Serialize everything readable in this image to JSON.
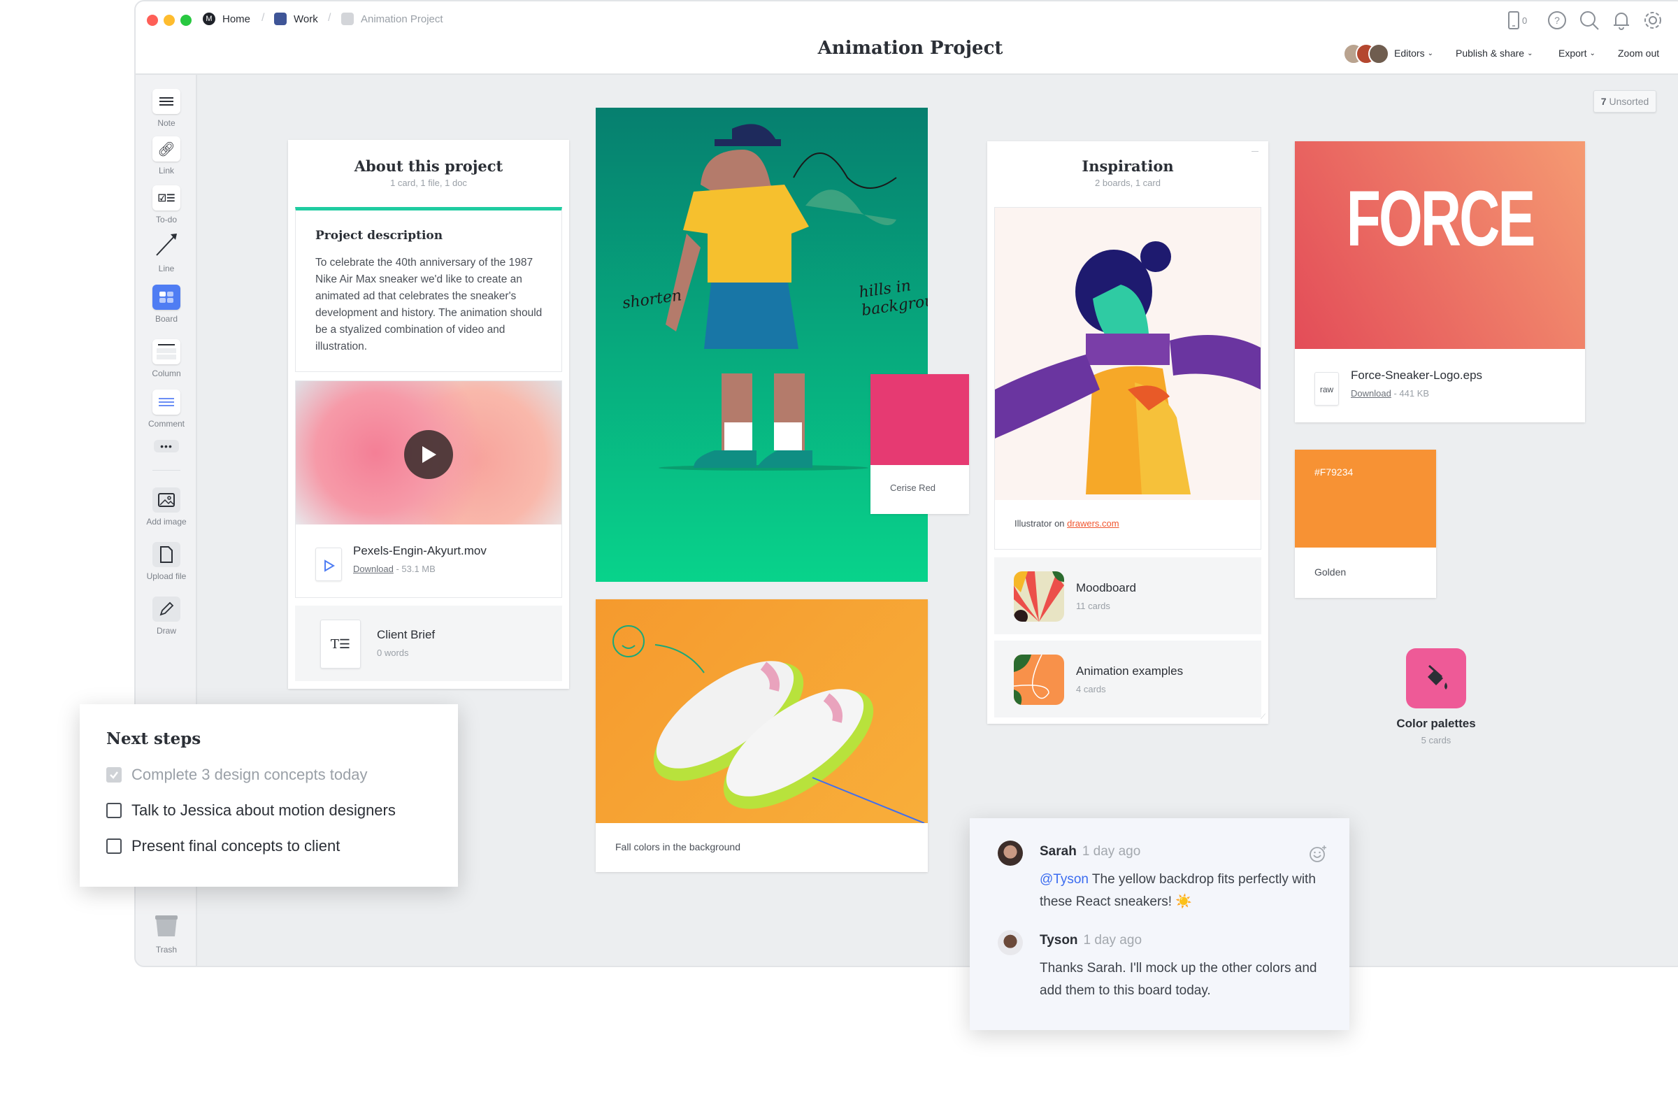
{
  "titlebar": {
    "breadcrumbs": [
      {
        "label": "Home",
        "icon": "milanote-logo-icon",
        "color": "#1f2229"
      },
      {
        "label": "Work",
        "icon": "board-icon",
        "color": "#3f5597"
      },
      {
        "label": "Animation Project",
        "icon": "board-icon",
        "color": "#d3d5d9"
      }
    ],
    "page_title": "Animation Project",
    "device_count": "0",
    "icons": [
      "mobile-icon",
      "help-icon",
      "search-icon",
      "bell-icon",
      "gear-icon"
    ],
    "menus": {
      "editors": "Editors",
      "publish": "Publish & share",
      "export": "Export",
      "zoom_out": "Zoom out"
    }
  },
  "sidebar": {
    "tools": [
      {
        "label": "Note",
        "icon": "note-icon"
      },
      {
        "label": "Link",
        "icon": "link-icon"
      },
      {
        "label": "To-do",
        "icon": "todo-icon"
      },
      {
        "label": "Line",
        "icon": "line-arrow-icon"
      },
      {
        "label": "Board",
        "icon": "board-icon"
      },
      {
        "label": "Column",
        "icon": "column-icon"
      },
      {
        "label": "Comment",
        "icon": "comment-icon"
      },
      {
        "label": "",
        "icon": "more-icon"
      },
      {
        "label": "Add image",
        "icon": "image-icon"
      },
      {
        "label": "Upload file",
        "icon": "file-icon"
      },
      {
        "label": "Draw",
        "icon": "pencil-icon"
      }
    ],
    "trash": "Trash"
  },
  "unsorted": {
    "count": "7",
    "label": "Unsorted"
  },
  "about": {
    "title": "About this project",
    "subtitle": "1 card, 1 file, 1 doc",
    "accent": "#1fcca1",
    "description_title": "Project description",
    "description": "To celebrate the 40th anniversary of the 1987 Nike Air Max sneaker we'd like to create an animated ad that celebrates the sneaker's development and history. The animation should be a styalized combination of video and illustration.",
    "video_file": {
      "name": "Pexels-Engin-Akyurt.mov",
      "download": "Download",
      "size": "53.1 MB"
    },
    "doc": {
      "name": "Client Brief",
      "meta": "0 words"
    }
  },
  "illustration": {
    "annotations": [
      "shorten",
      "hills in background"
    ]
  },
  "swatches": [
    {
      "name": "Cerise Red",
      "color": "#e63a72",
      "hex_label": ""
    },
    {
      "name": "Golden",
      "color": "#f79234",
      "hex_label": "#F79234"
    }
  ],
  "shoes_card": {
    "caption": "Fall colors in the background"
  },
  "inspiration": {
    "title": "Inspiration",
    "subtitle": "2 boards, 1 card",
    "image_caption_prefix": "Illustrator on",
    "image_caption_link": "drawers.com",
    "boards": [
      {
        "name": "Moodboard",
        "meta": "11 cards"
      },
      {
        "name": "Animation examples",
        "meta": "4 cards"
      }
    ]
  },
  "force_file": {
    "logo_text": "FORCE",
    "name": "Force-Sneaker-Logo.eps",
    "type_label": "raw",
    "download": "Download",
    "size": "441 KB"
  },
  "color_palettes": {
    "name": "Color palettes",
    "meta": "5 cards",
    "color": "#ee5a97"
  },
  "next_steps": {
    "title": "Next steps",
    "items": [
      {
        "text": "Complete 3 design concepts today",
        "checked": true
      },
      {
        "text": "Talk to Jessica about motion designers",
        "checked": false
      },
      {
        "text": "Present final concepts to client",
        "checked": false
      }
    ]
  },
  "comments": [
    {
      "author": "Sarah",
      "time": "1 day ago",
      "mention": "@Tyson",
      "text": "The yellow backdrop fits perfectly with these React sneakers! ☀️"
    },
    {
      "author": "Tyson",
      "time": "1 day ago",
      "mention": "",
      "text": "Thanks Sarah. I'll mock up the other colors and add them to this board today."
    }
  ]
}
